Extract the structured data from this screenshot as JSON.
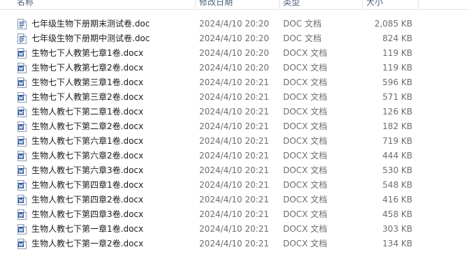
{
  "columns": {
    "name": "名称",
    "date": "修改日期",
    "type": "类型",
    "size": "大小"
  },
  "icon": "word-document-icon",
  "colors": {
    "word_blue": "#2b579a",
    "header_text": "#4c607a",
    "secondary_text": "#6d6d6d"
  },
  "files": [
    {
      "name": "七年级生物下册期末测试卷.doc",
      "date": "2024/4/10 20:20",
      "type": "DOC 文档",
      "size": "2,085 KB",
      "kind": "doc"
    },
    {
      "name": "七年级生物下册期中测试卷.doc",
      "date": "2024/4/10 20:20",
      "type": "DOC 文档",
      "size": "824 KB",
      "kind": "doc"
    },
    {
      "name": "生物七下人教第七章1卷.docx",
      "date": "2024/4/10 20:20",
      "type": "DOCX 文档",
      "size": "119 KB",
      "kind": "docx"
    },
    {
      "name": "生物七下人教第七章2卷.docx",
      "date": "2024/4/10 20:20",
      "type": "DOCX 文档",
      "size": "119 KB",
      "kind": "docx"
    },
    {
      "name": "生物七下人教第三章1卷.docx",
      "date": "2024/4/10 20:21",
      "type": "DOCX 文档",
      "size": "596 KB",
      "kind": "docx"
    },
    {
      "name": "生物七下人教第三章2卷.docx",
      "date": "2024/4/10 20:21",
      "type": "DOCX 文档",
      "size": "571 KB",
      "kind": "docx"
    },
    {
      "name": "生物人教七下第二章1卷.docx",
      "date": "2024/4/10 20:21",
      "type": "DOCX 文档",
      "size": "126 KB",
      "kind": "docx"
    },
    {
      "name": "生物人教七下第二章2卷.docx",
      "date": "2024/4/10 20:21",
      "type": "DOCX 文档",
      "size": "182 KB",
      "kind": "docx"
    },
    {
      "name": "生物人教七下第六章1卷.docx",
      "date": "2024/4/10 20:21",
      "type": "DOCX 文档",
      "size": "719 KB",
      "kind": "docx"
    },
    {
      "name": "生物人教七下第六章2卷.docx",
      "date": "2024/4/10 20:21",
      "type": "DOCX 文档",
      "size": "444 KB",
      "kind": "docx"
    },
    {
      "name": "生物人教七下第六章3卷.docx",
      "date": "2024/4/10 20:21",
      "type": "DOCX 文档",
      "size": "530 KB",
      "kind": "docx"
    },
    {
      "name": "生物人教七下第四章1卷.docx",
      "date": "2024/4/10 20:21",
      "type": "DOCX 文档",
      "size": "548 KB",
      "kind": "docx"
    },
    {
      "name": "生物人教七下第四章2卷.docx",
      "date": "2024/4/10 20:21",
      "type": "DOCX 文档",
      "size": "416 KB",
      "kind": "docx"
    },
    {
      "name": "生物人教七下第四章3卷.docx",
      "date": "2024/4/10 20:21",
      "type": "DOCX 文档",
      "size": "458 KB",
      "kind": "docx"
    },
    {
      "name": "生物人教七下第一章1卷.docx",
      "date": "2024/4/10 20:21",
      "type": "DOCX 文档",
      "size": "303 KB",
      "kind": "docx"
    },
    {
      "name": "生物人教七下第一章2卷.docx",
      "date": "2024/4/10 20:21",
      "type": "DOCX 文档",
      "size": "134 KB",
      "kind": "docx"
    }
  ]
}
